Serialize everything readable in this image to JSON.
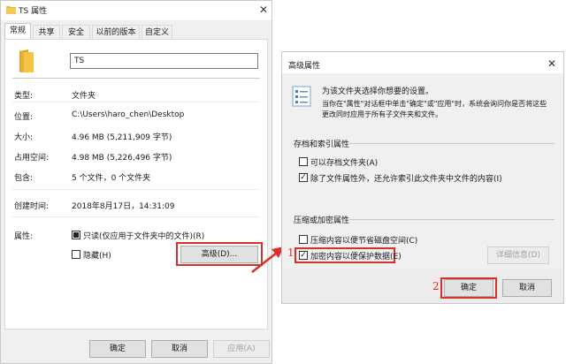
{
  "props": {
    "title": "TS 属性",
    "tabs": [
      "常规",
      "共享",
      "安全",
      "以前的版本",
      "自定义"
    ],
    "name_value": "TS",
    "rows": [
      {
        "label": "类型:",
        "value": "文件夹"
      },
      {
        "label": "位置:",
        "value": "C:\\Users\\haro_chen\\Desktop"
      },
      {
        "label": "大小:",
        "value": "4.96 MB (5,211,909 字节)"
      },
      {
        "label": "占用空间:",
        "value": "4.98 MB (5,226,496 字节)"
      },
      {
        "label": "包含:",
        "value": "5 个文件，0 个文件夹"
      },
      {
        "label": "创建时间:",
        "value": "2018年8月17日，14:31:09"
      }
    ],
    "attr_label": "属性:",
    "readonly_label": "只读(仅应用于文件夹中的文件)(R)",
    "hidden_label": "隐藏(H)",
    "advanced_button": "高级(D)...",
    "ok": "确定",
    "cancel": "取消",
    "apply": "应用(A)"
  },
  "adv": {
    "title": "高级属性",
    "intro_line1": "为该文件夹选择你想要的设置。",
    "intro_line2": "当你在\"属性\"对话框中单击\"确定\"或\"应用\"时，系统会询问你是否将这些",
    "intro_line3": "更改同时应用于所有子文件夹和文件。",
    "group1": "存档和索引属性",
    "archive": "可以存档文件夹(A)",
    "index": "除了文件属性外，还允许索引此文件夹中文件的内容(I)",
    "group2": "压缩或加密属性",
    "compress": "压缩内容以便节省磁盘空间(C)",
    "encrypt": "加密内容以便保护数据(E)",
    "details": "详细信息(D)",
    "ok": "确定",
    "cancel": "取消"
  },
  "steps": {
    "one": "1",
    "two": "2"
  }
}
